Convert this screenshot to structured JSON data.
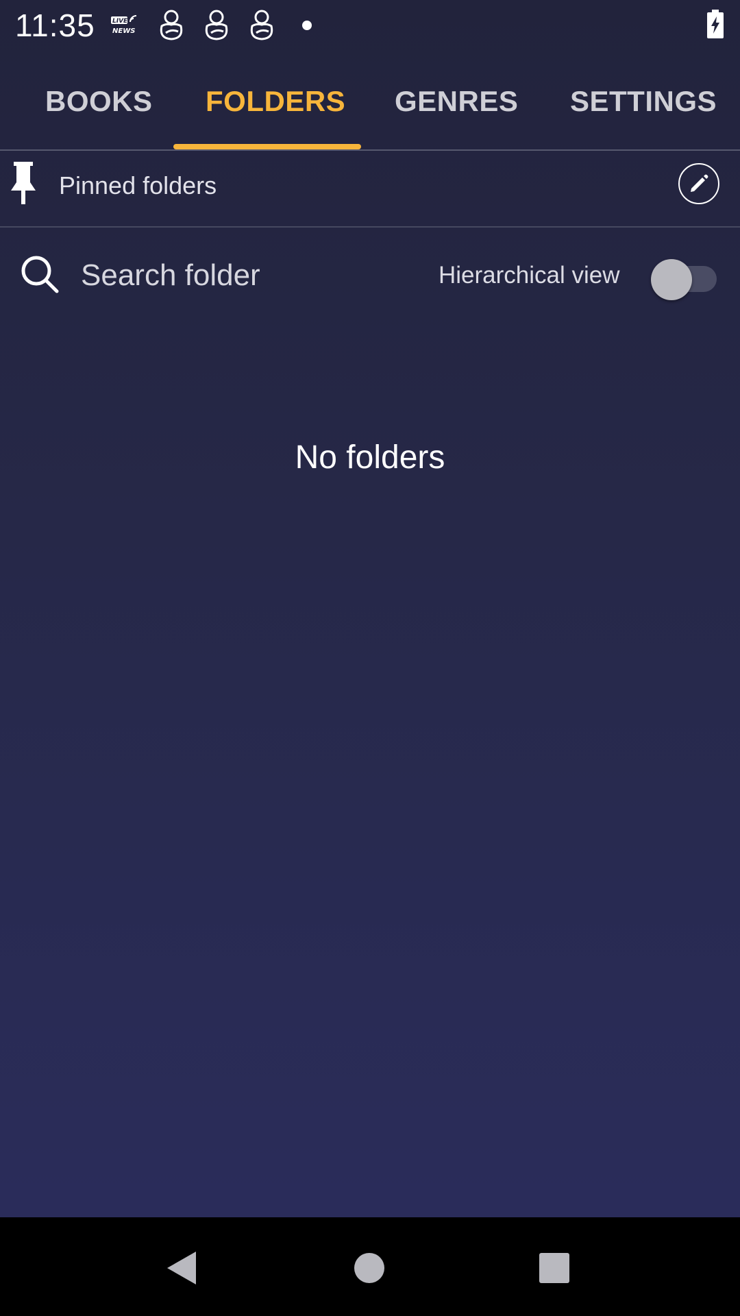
{
  "status_bar": {
    "time": "11:35",
    "icons": [
      "live-news-icon",
      "baby-icon",
      "baby-icon",
      "baby-icon",
      "notification-dot-icon",
      "battery-charging-icon"
    ]
  },
  "tabs": [
    {
      "label": "BOOKS",
      "active": false
    },
    {
      "label": "FOLDERS",
      "active": true
    },
    {
      "label": "GENRES",
      "active": false
    },
    {
      "label": "SETTINGS",
      "active": false
    }
  ],
  "pinned": {
    "label": "Pinned folders",
    "icon": "pin-icon",
    "edit_icon": "pencil-icon"
  },
  "search": {
    "placeholder": "Search folder",
    "value": ""
  },
  "hierarchical": {
    "label": "Hierarchical view",
    "enabled": false
  },
  "empty_state": {
    "text": "No folders"
  },
  "nav": {
    "buttons": [
      "back-icon",
      "home-icon",
      "recents-icon"
    ]
  },
  "colors": {
    "accent": "#f7b53b",
    "background_top": "#22233c",
    "background_bottom": "#2b2d5d"
  }
}
